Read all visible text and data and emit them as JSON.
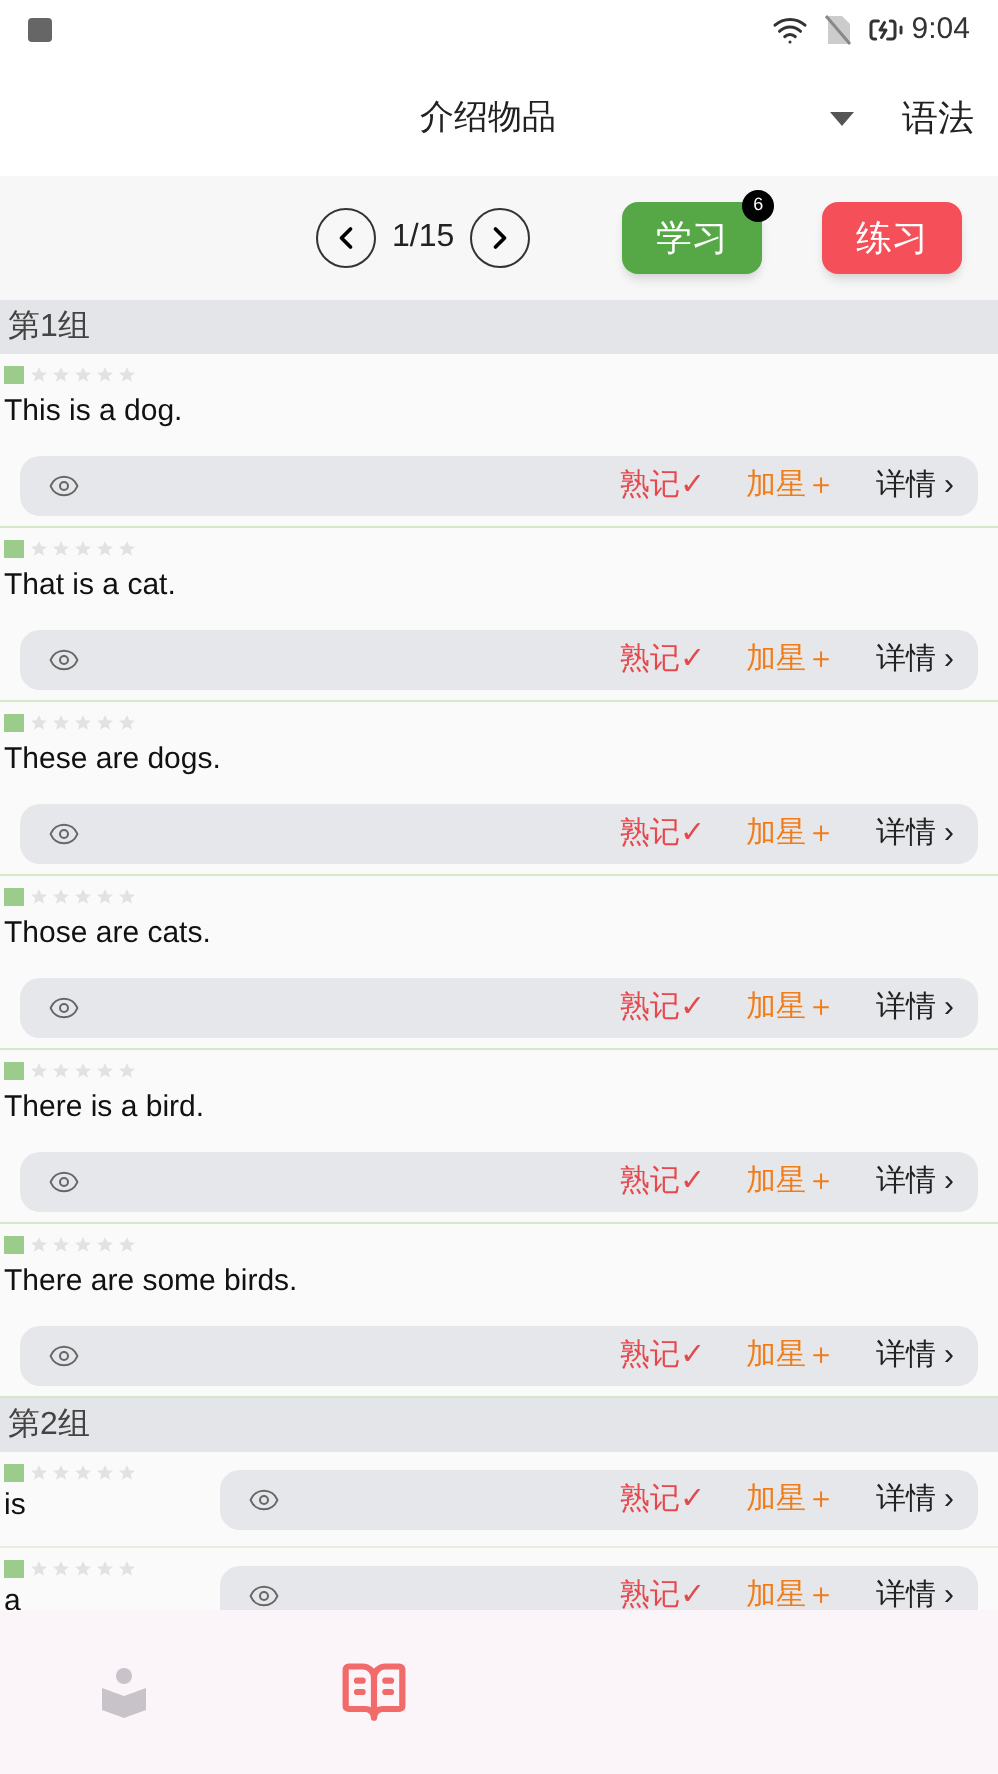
{
  "status_bar": {
    "time": "9:04"
  },
  "header": {
    "title": "介绍物品",
    "right_link": "语法"
  },
  "pager": {
    "page": "1/15"
  },
  "actions": [
    {
      "label": "学习",
      "badge": "6",
      "kind": "study"
    },
    {
      "label": "练习",
      "kind": "practice"
    }
  ],
  "groups": [
    {
      "title": "第1组",
      "kind": "sentence",
      "items": [
        {
          "text": "This is a dog.",
          "stars": 0,
          "buttons": [
            "熟记✓",
            "加星＋",
            "详情 ›"
          ]
        },
        {
          "text": "That is a cat.",
          "stars": 0,
          "buttons": [
            "熟记✓",
            "加星＋",
            "详情 ›"
          ]
        },
        {
          "text": "These are dogs.",
          "stars": 0,
          "buttons": [
            "熟记✓",
            "加星＋",
            "详情 ›"
          ]
        },
        {
          "text": "Those are cats.",
          "stars": 0,
          "buttons": [
            "熟记✓",
            "加星＋",
            "详情 ›"
          ]
        },
        {
          "text": "There is a bird.",
          "stars": 0,
          "buttons": [
            "熟记✓",
            "加星＋",
            "详情 ›"
          ]
        },
        {
          "text": "There are some birds.",
          "stars": 0,
          "buttons": [
            "熟记✓",
            "加星＋",
            "详情 ›"
          ]
        }
      ]
    },
    {
      "title": "第2组",
      "kind": "word",
      "items": [
        {
          "text": "is",
          "stars": 0,
          "buttons": [
            "熟记✓",
            "加星＋",
            "详情 ›"
          ]
        },
        {
          "text": "a",
          "stars": 0,
          "buttons": [
            "熟记✓",
            "加星＋",
            "详情 ›"
          ]
        }
      ]
    }
  ],
  "nav_tabs": [
    {
      "selected": false
    },
    {
      "selected": true
    }
  ]
}
